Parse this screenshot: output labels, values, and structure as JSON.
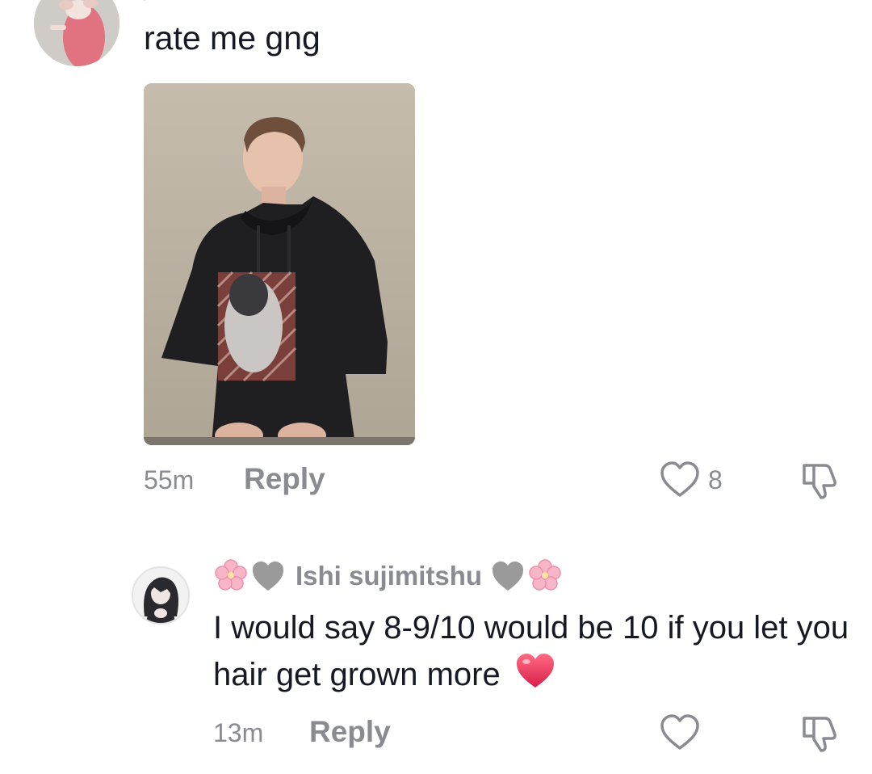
{
  "top_comment": {
    "username_fragment": "/",
    "text": "rate me gng",
    "time": "55m",
    "reply_label": "Reply",
    "like_count": "8",
    "icons": {
      "like": "heart-outline-icon",
      "dislike": "thumbs-down-icon"
    }
  },
  "reply_comment": {
    "username": "Ishi sujimitshu",
    "text": "I would say 8-9/10 would be 10 if you let you hair get grown more",
    "time": "13m",
    "reply_label": "Reply",
    "icons": {
      "name_decoration": [
        "cherry-blossom-icon",
        "grey-heart-icon"
      ],
      "text_emoji": "red-heart-icon",
      "like": "heart-outline-icon",
      "dislike": "thumbs-down-icon"
    }
  },
  "colors": {
    "text": "#161823",
    "secondary": "#8a8b91",
    "heart": "#e8375a",
    "blossom": "#f7b6c8",
    "grey_heart": "#9a9a9a"
  }
}
